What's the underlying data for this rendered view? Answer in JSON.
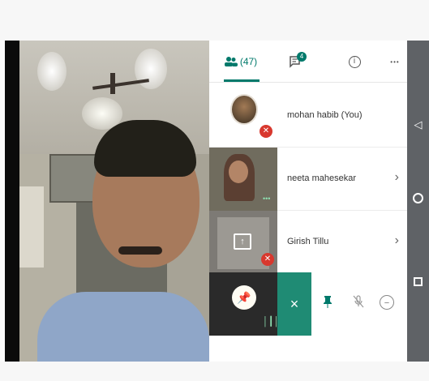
{
  "tabs": {
    "people_count": "(47)",
    "chat_badge": "4",
    "info_icon": "i",
    "more_icon": "•••"
  },
  "participants": [
    {
      "name": "mohan habib (You)",
      "muted": true
    },
    {
      "name": "neeta mahesekar",
      "muted": false
    },
    {
      "name": "Girish Tillu",
      "muted": true
    }
  ],
  "actions": {
    "close": "×",
    "pin": "pin-icon",
    "mute": "mic-off-icon",
    "remove": "−"
  },
  "colors": {
    "accent": "#00796b",
    "action_bar_close": "#1f8b74",
    "muted_red": "#d8382e",
    "nav_bar": "#5f6266"
  }
}
